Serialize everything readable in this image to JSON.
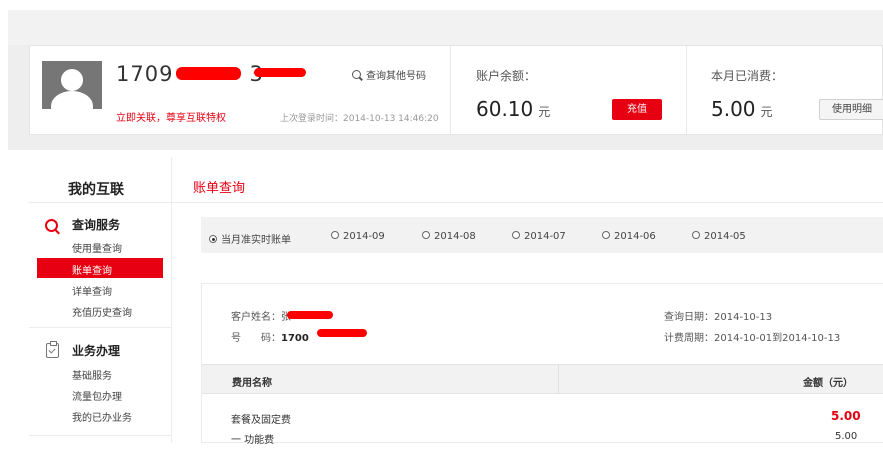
{
  "account": {
    "phone": "1709",
    "phone_suffix": "3",
    "search_other": "查询其他号码",
    "link_bind": "立即关联，尊享互联特权",
    "last_login": "上次登录时间：2014-10-13 14:46:20",
    "balance_label": "账户余额：",
    "balance_value": "60.10",
    "balance_unit": "元",
    "recharge_button": "充值",
    "spent_label": "本月已消费：",
    "spent_value": "5.00",
    "spent_unit": "元",
    "detail_button": "使用明细"
  },
  "sidebar": {
    "title": "我的互联",
    "sections": [
      {
        "heading": "查询服务",
        "icon": "search-icon",
        "items": [
          "使用量查询",
          "账单查询",
          "详单查询",
          "充值历史查询"
        ],
        "active": 1
      },
      {
        "heading": "业务办理",
        "icon": "clipboard-check-icon",
        "items": [
          "基础服务",
          "流量包办理",
          "我的已办业务"
        ]
      }
    ]
  },
  "content": {
    "title": "账单查询",
    "tabs": [
      "当月准实时账单",
      "2014-09",
      "2014-08",
      "2014-07",
      "2014-06",
      "2014-05"
    ],
    "selected_tab": 0,
    "customer_label": "客户姓名：",
    "customer_name": "张",
    "number_label": "号　　码：",
    "number_value": "1700",
    "query_date_label": "查询日期：",
    "query_date": "2014-10-13",
    "billing_period_label": "计费周期：",
    "billing_period": "2014-10-01到2014-10-13",
    "table": {
      "headers": [
        "费用名称",
        "金额（元）"
      ],
      "rows": [
        {
          "name": "套餐及固定费",
          "amount": "5.00"
        },
        {
          "name": "一 功能费",
          "amount": "5.00"
        }
      ]
    }
  },
  "colors": {
    "accent": "#e60012",
    "panel_bg": "#f2f2f2"
  }
}
